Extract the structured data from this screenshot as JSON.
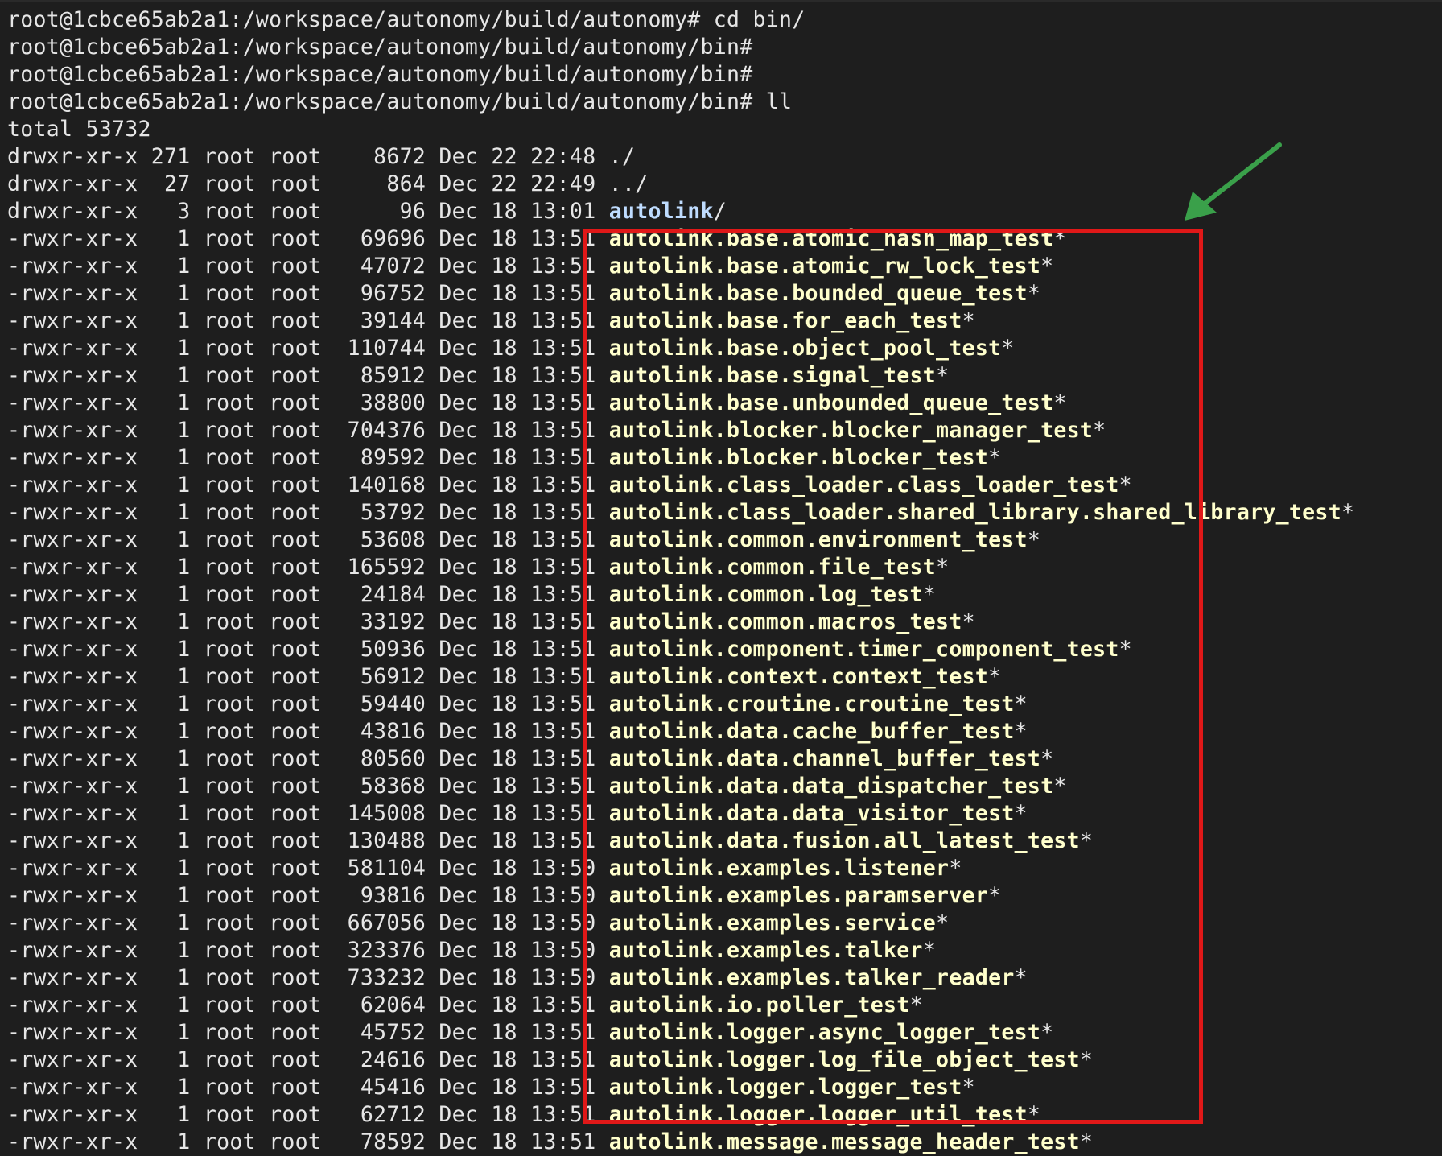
{
  "terminal": {
    "colors": {
      "background": "#1e1e1e",
      "text": "#e6e6e6",
      "executable": "#ffffcc",
      "directory": "#bfdcff",
      "highlight_box": "#e01818",
      "arrow": "#3aa04a"
    },
    "prompts": [
      "root@1cbce65ab2a1:/workspace/autonomy/build/autonomy# cd bin/",
      "root@1cbce65ab2a1:/workspace/autonomy/build/autonomy/bin#",
      "root@1cbce65ab2a1:/workspace/autonomy/build/autonomy/bin#",
      "root@1cbce65ab2a1:/workspace/autonomy/build/autonomy/bin# ll"
    ],
    "total": "total 53732",
    "listing": [
      {
        "meta": "drwxr-xr-x 271 root root    8672 Dec 22 22:48 ",
        "name": "./",
        "kind": "plain",
        "suffix": ""
      },
      {
        "meta": "drwxr-xr-x  27 root root     864 Dec 22 22:49 ",
        "name": "../",
        "kind": "plain",
        "suffix": ""
      },
      {
        "meta": "drwxr-xr-x   3 root root      96 Dec 18 13:01 ",
        "name": "autolink",
        "kind": "dir",
        "suffix": "/"
      },
      {
        "meta": "-rwxr-xr-x   1 root root   69696 Dec 18 13:51 ",
        "name": "autolink.base.atomic_hash_map_test",
        "kind": "exec",
        "suffix": "*"
      },
      {
        "meta": "-rwxr-xr-x   1 root root   47072 Dec 18 13:51 ",
        "name": "autolink.base.atomic_rw_lock_test",
        "kind": "exec",
        "suffix": "*"
      },
      {
        "meta": "-rwxr-xr-x   1 root root   96752 Dec 18 13:51 ",
        "name": "autolink.base.bounded_queue_test",
        "kind": "exec",
        "suffix": "*"
      },
      {
        "meta": "-rwxr-xr-x   1 root root   39144 Dec 18 13:51 ",
        "name": "autolink.base.for_each_test",
        "kind": "exec",
        "suffix": "*"
      },
      {
        "meta": "-rwxr-xr-x   1 root root  110744 Dec 18 13:51 ",
        "name": "autolink.base.object_pool_test",
        "kind": "exec",
        "suffix": "*"
      },
      {
        "meta": "-rwxr-xr-x   1 root root   85912 Dec 18 13:51 ",
        "name": "autolink.base.signal_test",
        "kind": "exec",
        "suffix": "*"
      },
      {
        "meta": "-rwxr-xr-x   1 root root   38800 Dec 18 13:51 ",
        "name": "autolink.base.unbounded_queue_test",
        "kind": "exec",
        "suffix": "*"
      },
      {
        "meta": "-rwxr-xr-x   1 root root  704376 Dec 18 13:51 ",
        "name": "autolink.blocker.blocker_manager_test",
        "kind": "exec",
        "suffix": "*"
      },
      {
        "meta": "-rwxr-xr-x   1 root root   89592 Dec 18 13:51 ",
        "name": "autolink.blocker.blocker_test",
        "kind": "exec",
        "suffix": "*"
      },
      {
        "meta": "-rwxr-xr-x   1 root root  140168 Dec 18 13:51 ",
        "name": "autolink.class_loader.class_loader_test",
        "kind": "exec",
        "suffix": "*"
      },
      {
        "meta": "-rwxr-xr-x   1 root root   53792 Dec 18 13:51 ",
        "name": "autolink.class_loader.shared_library.shared_library_test",
        "kind": "exec",
        "suffix": "*"
      },
      {
        "meta": "-rwxr-xr-x   1 root root   53608 Dec 18 13:51 ",
        "name": "autolink.common.environment_test",
        "kind": "exec",
        "suffix": "*"
      },
      {
        "meta": "-rwxr-xr-x   1 root root  165592 Dec 18 13:51 ",
        "name": "autolink.common.file_test",
        "kind": "exec",
        "suffix": "*"
      },
      {
        "meta": "-rwxr-xr-x   1 root root   24184 Dec 18 13:51 ",
        "name": "autolink.common.log_test",
        "kind": "exec",
        "suffix": "*"
      },
      {
        "meta": "-rwxr-xr-x   1 root root   33192 Dec 18 13:51 ",
        "name": "autolink.common.macros_test",
        "kind": "exec",
        "suffix": "*"
      },
      {
        "meta": "-rwxr-xr-x   1 root root   50936 Dec 18 13:51 ",
        "name": "autolink.component.timer_component_test",
        "kind": "exec",
        "suffix": "*"
      },
      {
        "meta": "-rwxr-xr-x   1 root root   56912 Dec 18 13:51 ",
        "name": "autolink.context.context_test",
        "kind": "exec",
        "suffix": "*"
      },
      {
        "meta": "-rwxr-xr-x   1 root root   59440 Dec 18 13:51 ",
        "name": "autolink.croutine.croutine_test",
        "kind": "exec",
        "suffix": "*"
      },
      {
        "meta": "-rwxr-xr-x   1 root root   43816 Dec 18 13:51 ",
        "name": "autolink.data.cache_buffer_test",
        "kind": "exec",
        "suffix": "*"
      },
      {
        "meta": "-rwxr-xr-x   1 root root   80560 Dec 18 13:51 ",
        "name": "autolink.data.channel_buffer_test",
        "kind": "exec",
        "suffix": "*"
      },
      {
        "meta": "-rwxr-xr-x   1 root root   58368 Dec 18 13:51 ",
        "name": "autolink.data.data_dispatcher_test",
        "kind": "exec",
        "suffix": "*"
      },
      {
        "meta": "-rwxr-xr-x   1 root root  145008 Dec 18 13:51 ",
        "name": "autolink.data.data_visitor_test",
        "kind": "exec",
        "suffix": "*"
      },
      {
        "meta": "-rwxr-xr-x   1 root root  130488 Dec 18 13:51 ",
        "name": "autolink.data.fusion.all_latest_test",
        "kind": "exec",
        "suffix": "*"
      },
      {
        "meta": "-rwxr-xr-x   1 root root  581104 Dec 18 13:50 ",
        "name": "autolink.examples.listener",
        "kind": "exec",
        "suffix": "*"
      },
      {
        "meta": "-rwxr-xr-x   1 root root   93816 Dec 18 13:50 ",
        "name": "autolink.examples.paramserver",
        "kind": "exec",
        "suffix": "*"
      },
      {
        "meta": "-rwxr-xr-x   1 root root  667056 Dec 18 13:50 ",
        "name": "autolink.examples.service",
        "kind": "exec",
        "suffix": "*"
      },
      {
        "meta": "-rwxr-xr-x   1 root root  323376 Dec 18 13:50 ",
        "name": "autolink.examples.talker",
        "kind": "exec",
        "suffix": "*"
      },
      {
        "meta": "-rwxr-xr-x   1 root root  733232 Dec 18 13:50 ",
        "name": "autolink.examples.talker_reader",
        "kind": "exec",
        "suffix": "*"
      },
      {
        "meta": "-rwxr-xr-x   1 root root   62064 Dec 18 13:51 ",
        "name": "autolink.io.poller_test",
        "kind": "exec",
        "suffix": "*"
      },
      {
        "meta": "-rwxr-xr-x   1 root root   45752 Dec 18 13:51 ",
        "name": "autolink.logger.async_logger_test",
        "kind": "exec",
        "suffix": "*"
      },
      {
        "meta": "-rwxr-xr-x   1 root root   24616 Dec 18 13:51 ",
        "name": "autolink.logger.log_file_object_test",
        "kind": "exec",
        "suffix": "*"
      },
      {
        "meta": "-rwxr-xr-x   1 root root   45416 Dec 18 13:51 ",
        "name": "autolink.logger.logger_test",
        "kind": "exec",
        "suffix": "*"
      },
      {
        "meta": "-rwxr-xr-x   1 root root   62712 Dec 18 13:51 ",
        "name": "autolink.logger.logger_util_test",
        "kind": "exec",
        "suffix": "*"
      },
      {
        "meta": "-rwxr-xr-x   1 root root   78592 Dec 18 13:51 ",
        "name": "autolink.message.message_header_test",
        "kind": "exec",
        "suffix": "*"
      }
    ]
  }
}
